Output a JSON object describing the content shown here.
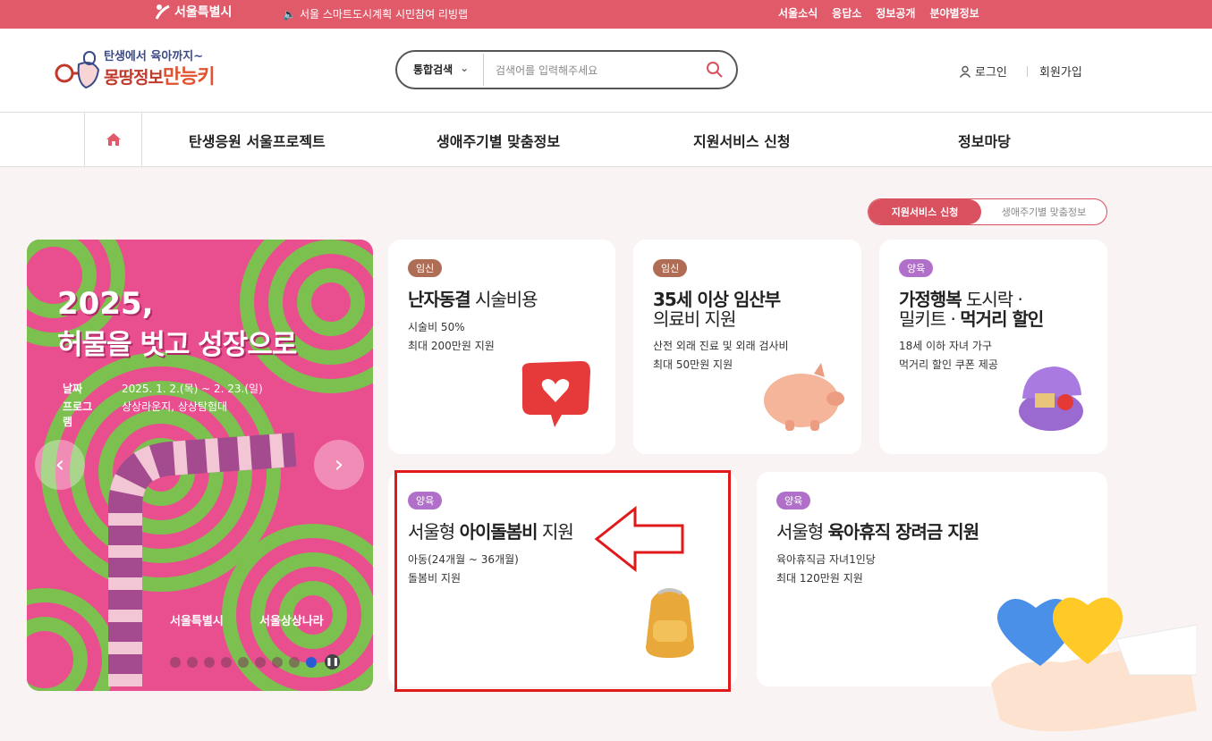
{
  "topbar": {
    "brand": "서울특별시",
    "notice": "서울 스마트도시계획 시민참여 리빙랩",
    "links": [
      "서울소식",
      "응답소",
      "정보공개",
      "분야별정보"
    ]
  },
  "header": {
    "logo_line1": "탄생에서 육아까지~",
    "logo_line2": "몽땅정보",
    "logo_line3": "만능키",
    "search_category": "통합검색",
    "search_placeholder": "검색어를 입력해주세요",
    "login": "로그인",
    "join": "회원가입"
  },
  "nav": {
    "items": [
      "탄생응원 서울프로젝트",
      "생애주기별 맞춤정보",
      "지원서비스 신청",
      "정보마당"
    ]
  },
  "toggle": {
    "active": "지원서비스 신청",
    "inactive": "생애주기별 맞춤정보"
  },
  "banner": {
    "title1": "2025,",
    "title2": "허물을 벗고 성장으로",
    "date_label": "날짜",
    "date_value": "2025. 1. 2.(목) ~ 2. 23.(일)",
    "program_label": "프로그램",
    "program_value": "상상라운지, 상상탐험대",
    "org1": "서울특별시",
    "org2": "서울상상나라",
    "slide_count": 9,
    "active_slide": 9
  },
  "cards": [
    {
      "badge": "임신",
      "title_bold": "난자동결",
      "title_rest": " 시술비용",
      "desc1": "시술비 50%",
      "desc2": "최대 200만원 지원"
    },
    {
      "badge": "임신",
      "title_bold": "35세 이상 임산부",
      "title_rest": "의료비 지원",
      "desc1": "산전 외래 진료 및 외래 검사비",
      "desc2": "최대 50만원 지원"
    },
    {
      "badge": "양육",
      "title_bold": "가정행복",
      "title_rest": " 도시락 ·",
      "title_line2_a": "밀키트 · ",
      "title_line2_b": "먹거리 할인",
      "desc1": "18세 이하 자녀 가구",
      "desc2": "먹거리 할인 쿠폰 제공"
    },
    {
      "badge": "양육",
      "title_pre": "서울형 ",
      "title_bold": "아이돌봄비",
      "title_rest": " 지원",
      "desc1": "아동(24개월 ~ 36개월)",
      "desc2": "돌봄비 지원"
    },
    {
      "badge": "양육",
      "title_pre": "서울형 ",
      "title_bold": "육아휴직 장려금 지원",
      "desc1": "육아휴직금 자녀1인당",
      "desc2": "최대 120만원 지원"
    }
  ],
  "colors": {
    "topbar": "#e05a6a",
    "accent": "#d9505e",
    "highlight": "#e01a1a",
    "banner": "#e94f8f"
  }
}
